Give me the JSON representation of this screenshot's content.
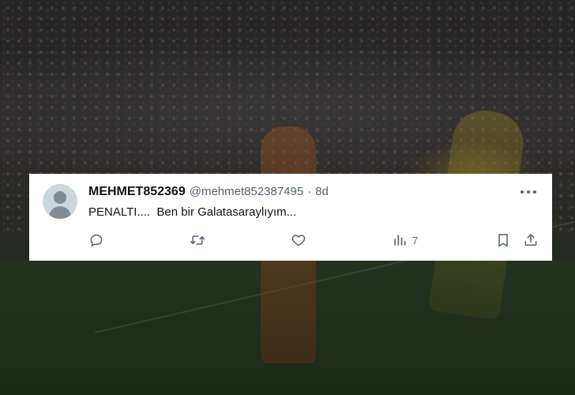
{
  "background": {
    "description_colors": {
      "overlay": "#1c1c1c",
      "pitch": "#1f2a1e"
    }
  },
  "tweet": {
    "display_name": "MEHMET852369",
    "handle": "@mehmet852387495",
    "separator": "·",
    "age": "8d",
    "text": "PENALTI....  Ben bir Galatasaraylıyım...",
    "icons": {
      "reply": "reply-icon",
      "retweet": "retweet-icon",
      "like": "heart-icon",
      "views": "views-chart-icon",
      "bookmark": "bookmark-icon",
      "share": "share-icon",
      "more": "more-icon"
    },
    "metrics": {
      "views": "7"
    },
    "colors": {
      "text": "#0f1419",
      "secondary": "#536471",
      "avatar_bg": "#ccd6dd",
      "card_bg": "#ffffff"
    }
  }
}
